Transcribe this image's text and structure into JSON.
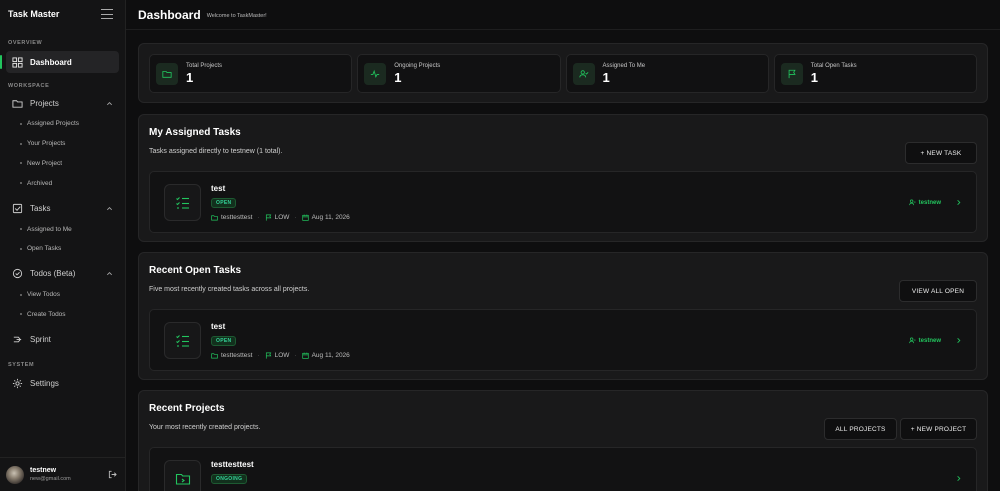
{
  "sidebar": {
    "title": "Task Master",
    "sections": {
      "overview": "OVERVIEW",
      "workspace": "WORKSPACE",
      "system": "SYSTEM"
    },
    "dashboard": "Dashboard",
    "projects": {
      "label": "Projects",
      "items": [
        "Assigned Projects",
        "Your Projects",
        "New Project",
        "Archived"
      ]
    },
    "tasks": {
      "label": "Tasks",
      "items": [
        "Assigned to Me",
        "Open Tasks"
      ]
    },
    "todos": {
      "label": "Todos (Beta)",
      "items": [
        "View Todos",
        "Create Todos"
      ]
    },
    "sprint": "Sprint",
    "settings": "Settings",
    "user": {
      "name": "testnew",
      "email": "new@gmail.com"
    }
  },
  "header": {
    "title": "Dashboard",
    "subtitle": "Welcome to TaskMaster!"
  },
  "stats": [
    {
      "label": "Total Projects",
      "value": "1",
      "icon": "folder-icon"
    },
    {
      "label": "Ongoing Projects",
      "value": "1",
      "icon": "activity-icon"
    },
    {
      "label": "Assigned To Me",
      "value": "1",
      "icon": "user-check-icon"
    },
    {
      "label": "Total Open Tasks",
      "value": "1",
      "icon": "flag-icon"
    }
  ],
  "assigned_tasks": {
    "title": "My Assigned Tasks",
    "description": "Tasks assigned directly to testnew (1 total).",
    "button": "+ NEW TASK",
    "item": {
      "name": "test",
      "status": "OPEN",
      "project": "testtesttest",
      "priority": "LOW",
      "date": "Aug 11, 2026",
      "assignee": "testnew"
    }
  },
  "recent_open_tasks": {
    "title": "Recent Open Tasks",
    "description": "Five most recently created tasks across all projects.",
    "button": "VIEW ALL OPEN",
    "item": {
      "name": "test",
      "status": "OPEN",
      "project": "testtesttest",
      "priority": "LOW",
      "date": "Aug 11, 2026",
      "assignee": "testnew"
    }
  },
  "recent_projects": {
    "title": "Recent Projects",
    "description": "Your most recently created projects.",
    "button_all": "ALL PROJECTS",
    "button_new": "+ NEW PROJECT",
    "item": {
      "name": "testtesttest",
      "status": "ONGOING"
    }
  },
  "colors": {
    "accent": "#22c55e",
    "background": "#0e0e0f",
    "panel": "#19191a"
  }
}
